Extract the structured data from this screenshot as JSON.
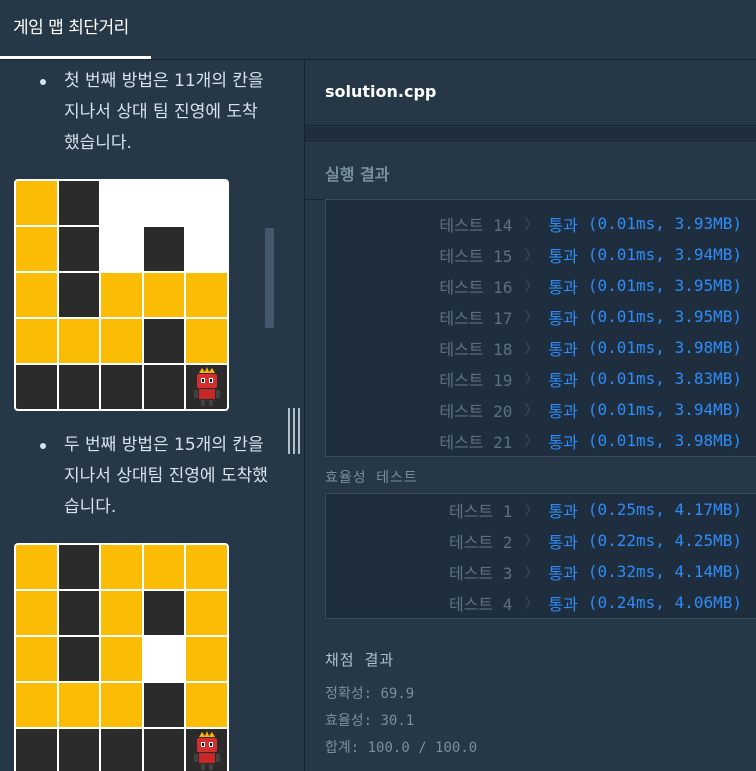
{
  "header": {
    "tab_title": "게임 맵 최단거리"
  },
  "problem": {
    "bullets": [
      "첫 번째 방법은 11개의 칸을 지나서 상대 팀 진영에 도착했습니다.",
      "두 번째 방법은 15개의 칸을 지나서 상대팀 진영에 도착했습니다."
    ],
    "maps": [
      {
        "cells": [
          "y",
          "b",
          "w",
          "w",
          "w",
          "y",
          "b",
          "w",
          "b",
          "w",
          "y",
          "b",
          "y",
          "y",
          "y",
          "y",
          "y",
          "y",
          "b",
          "y",
          "b",
          "b",
          "b",
          "b",
          "robot"
        ]
      },
      {
        "cells": [
          "y",
          "b",
          "y",
          "y",
          "y",
          "y",
          "b",
          "y",
          "b",
          "y",
          "y",
          "b",
          "y",
          "w",
          "y",
          "y",
          "y",
          "y",
          "b",
          "y",
          "b",
          "b",
          "b",
          "b",
          "robot"
        ]
      }
    ],
    "robot_icon": "robot-icon"
  },
  "editor": {
    "filename": "solution.cpp"
  },
  "results": {
    "title": "실행 결과",
    "correctness_tests": [
      {
        "label": "테스트 14",
        "status": "통과",
        "detail": "(0.01ms, 3.93MB)"
      },
      {
        "label": "테스트 15",
        "status": "통과",
        "detail": "(0.01ms, 3.94MB)"
      },
      {
        "label": "테스트 16",
        "status": "통과",
        "detail": "(0.01ms, 3.95MB)"
      },
      {
        "label": "테스트 17",
        "status": "통과",
        "detail": "(0.01ms, 3.95MB)"
      },
      {
        "label": "테스트 18",
        "status": "통과",
        "detail": "(0.01ms, 3.98MB)"
      },
      {
        "label": "테스트 19",
        "status": "통과",
        "detail": "(0.01ms, 3.83MB)"
      },
      {
        "label": "테스트 20",
        "status": "통과",
        "detail": "(0.01ms, 3.94MB)"
      },
      {
        "label": "테스트 21",
        "status": "통과",
        "detail": "(0.01ms, 3.98MB)"
      }
    ],
    "efficiency_label": "효율성  테스트",
    "efficiency_tests": [
      {
        "label": "테스트 1",
        "status": "통과",
        "detail": "(0.25ms, 4.17MB)"
      },
      {
        "label": "테스트 2",
        "status": "통과",
        "detail": "(0.22ms, 4.25MB)"
      },
      {
        "label": "테스트 3",
        "status": "통과",
        "detail": "(0.32ms, 4.14MB)"
      },
      {
        "label": "테스트 4",
        "status": "통과",
        "detail": "(0.24ms, 4.06MB)"
      }
    ],
    "score": {
      "title": "채점 결과",
      "correctness": "정확성: 69.9",
      "efficiency": "효율성: 30.1",
      "total": "합계: 100.0 / 100.0"
    }
  },
  "colors": {
    "pass": "#2f8cf6",
    "map_yellow": "#fbbc05",
    "map_black": "#2b2b2b",
    "bg": "#263747"
  }
}
